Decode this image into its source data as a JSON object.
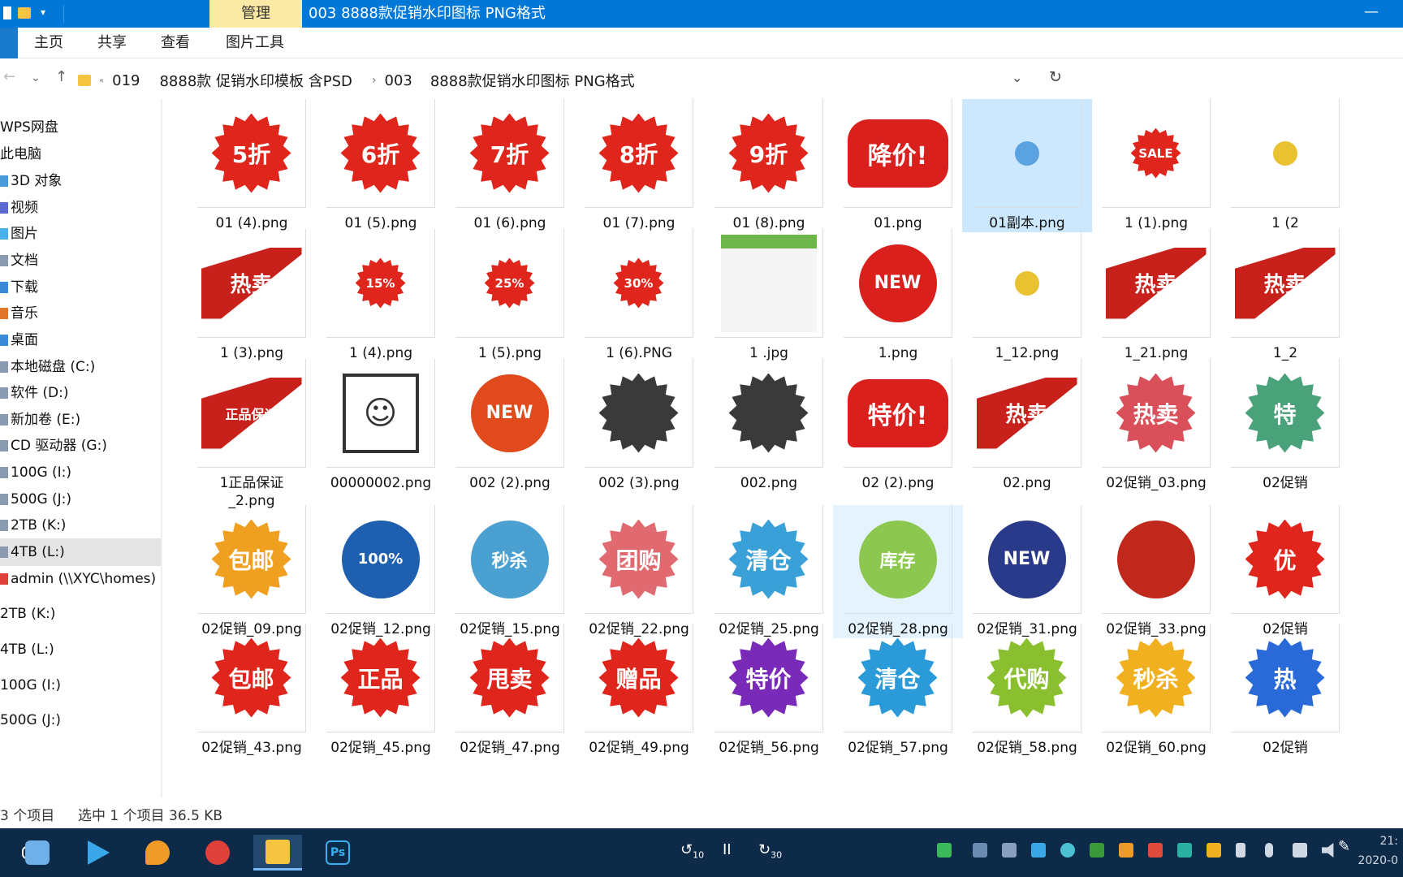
{
  "window": {
    "context_tab": "管理",
    "title": "003    8888款促销水印图标 PNG格式",
    "minimize": "—"
  },
  "ribbon": {
    "tabs": [
      "主页",
      "共享",
      "查看",
      "图片工具"
    ]
  },
  "address": {
    "crumbs": [
      "019",
      "8888款 促销水印模板 含PSD",
      "003",
      "8888款促销水印图标 PNG格式"
    ],
    "dropdown_icon": "chevron-down-icon",
    "refresh_icon": "refresh-icon"
  },
  "sidebar": {
    "items": [
      "WPS网盘",
      "此电脑",
      "3D 对象",
      "视频",
      "图片",
      "文档",
      "下载",
      "音乐",
      "桌面",
      "本地磁盘 (C:)",
      "软件 (D:)",
      "新加卷 (E:)",
      "CD 驱动器 (G:)",
      "100G  (I:)",
      "500G (J:)",
      "2TB (K:)",
      "4TB (L:)",
      "admin (\\\\XYC\\homes)",
      "2TB (K:)",
      "4TB (L:)",
      "100G  (I:)",
      "500G (J:)"
    ],
    "selected_index": 16
  },
  "files": {
    "rows": [
      [
        {
          "name": "01 (4).png",
          "badge": "5折",
          "color": "#e0261c",
          "shape": "burst"
        },
        {
          "name": "01 (5).png",
          "badge": "6折",
          "color": "#e0261c",
          "shape": "burst"
        },
        {
          "name": "01 (6).png",
          "badge": "7折",
          "color": "#e0261c",
          "shape": "burst"
        },
        {
          "name": "01 (7).png",
          "badge": "8折",
          "color": "#e0261c",
          "shape": "burst"
        },
        {
          "name": "01 (8).png",
          "badge": "9折",
          "color": "#e0261c",
          "shape": "burst"
        },
        {
          "name": "01.png",
          "badge": "降价!",
          "color": "#d9201c",
          "shape": "bubble"
        },
        {
          "name": "01副本.png",
          "badge": "",
          "color": "#5aa3e0",
          "shape": "dot"
        },
        {
          "name": "1 (1).png",
          "badge": "SALE",
          "color": "#e0261c",
          "shape": "burst-small"
        },
        {
          "name": "1 (2",
          "badge": "",
          "color": "#e8c230",
          "shape": "dot"
        }
      ],
      [
        {
          "name": "1 (3).png",
          "badge": "热卖",
          "color": "#c8201a",
          "shape": "corner"
        },
        {
          "name": "1 (4).png",
          "badge": "15%",
          "color": "#e0261c",
          "shape": "burst-small"
        },
        {
          "name": "1 (5).png",
          "badge": "25%",
          "color": "#e0261c",
          "shape": "burst-small"
        },
        {
          "name": "1 (6).PNG",
          "badge": "30%",
          "color": "#e0261c",
          "shape": "burst-small"
        },
        {
          "name": "1 .jpg",
          "badge": "",
          "color": "#6fb64a",
          "shape": "sheet"
        },
        {
          "name": "1.png",
          "badge": "NEW",
          "color": "#d9201c",
          "shape": "round"
        },
        {
          "name": "1_12.png",
          "badge": "",
          "color": "#e8c230",
          "shape": "dot"
        },
        {
          "name": "1_21.png",
          "badge": "热卖",
          "color": "#c8201a",
          "shape": "corner"
        },
        {
          "name": "1_2",
          "badge": "热卖",
          "color": "#c8201a",
          "shape": "corner"
        }
      ],
      [
        {
          "name": "1正品保证\n_2.png",
          "badge": "正品保证",
          "color": "#c8201a",
          "shape": "corner"
        },
        {
          "name": "00000002.png",
          "badge": "☺",
          "color": "#333333",
          "shape": "frame"
        },
        {
          "name": "002 (2).png",
          "badge": "NEW",
          "color": "#e04a1c",
          "shape": "round"
        },
        {
          "name": "002 (3).png",
          "badge": "",
          "color": "#3a3a3a",
          "shape": "burst"
        },
        {
          "name": "002.png",
          "badge": "",
          "color": "#3a3a3a",
          "shape": "burst"
        },
        {
          "name": "02 (2).png",
          "badge": "特价!",
          "color": "#d9201c",
          "shape": "bubble"
        },
        {
          "name": "02.png",
          "badge": "热卖",
          "color": "#c8201a",
          "shape": "corner"
        },
        {
          "name": "02促销_03.png",
          "badge": "热卖",
          "color": "#d9505a",
          "shape": "burst"
        },
        {
          "name": "02促销",
          "badge": "特",
          "color": "#4aa27a",
          "shape": "burst"
        }
      ],
      [
        {
          "name": "02促销_09.png",
          "badge": "包邮",
          "color": "#f0a020",
          "shape": "burst"
        },
        {
          "name": "02促销_12.png",
          "badge": "100%",
          "color": "#1e5fb0",
          "shape": "round"
        },
        {
          "name": "02促销_15.png",
          "badge": "秒杀",
          "color": "#4aa0d0",
          "shape": "round"
        },
        {
          "name": "02促销_22.png",
          "badge": "团购",
          "color": "#e06a70",
          "shape": "burst"
        },
        {
          "name": "02促销_25.png",
          "badge": "清仓",
          "color": "#3aa0d8",
          "shape": "burst"
        },
        {
          "name": "02促销_28.png",
          "badge": "库存",
          "color": "#8cc850",
          "shape": "round"
        },
        {
          "name": "02促销_31.png",
          "badge": "NEW",
          "color": "#2a3a8a",
          "shape": "round"
        },
        {
          "name": "02促销_33.png",
          "badge": "",
          "color": "#c0281c",
          "shape": "round"
        },
        {
          "name": "02促销",
          "badge": "优",
          "color": "#e0261c",
          "shape": "burst"
        }
      ],
      [
        {
          "name": "02促销_43.png",
          "badge": "包邮",
          "color": "#e0261c",
          "shape": "burst"
        },
        {
          "name": "02促销_45.png",
          "badge": "正品",
          "color": "#e0261c",
          "shape": "burst"
        },
        {
          "name": "02促销_47.png",
          "badge": "甩卖",
          "color": "#e0261c",
          "shape": "burst"
        },
        {
          "name": "02促销_49.png",
          "badge": "赠品",
          "color": "#e0261c",
          "shape": "burst"
        },
        {
          "name": "02促销_56.png",
          "badge": "特价",
          "color": "#7a2ab8",
          "shape": "burst"
        },
        {
          "name": "02促销_57.png",
          "badge": "清仓",
          "color": "#2a9ad8",
          "shape": "burst"
        },
        {
          "name": "02促销_58.png",
          "badge": "代购",
          "color": "#8ac030",
          "shape": "burst"
        },
        {
          "name": "02促销_60.png",
          "badge": "秒杀",
          "color": "#f0b020",
          "shape": "burst"
        },
        {
          "name": "02促销",
          "badge": "热",
          "color": "#2a6ad8",
          "shape": "burst"
        }
      ]
    ],
    "selected": "01副本.png",
    "hovered": "02促销_28.png"
  },
  "status": {
    "count": "3 个项目",
    "selection": "选中 1 个项目  36.5 KB"
  },
  "taskbar": {
    "apps": [
      "qq-icon",
      "video-player-icon",
      "fish-icon",
      "screen-recorder-icon",
      "file-explorer-icon",
      "photoshop-icon"
    ],
    "photoshop_label": "Ps",
    "player": {
      "back": "10",
      "pause": "II",
      "forward": "30"
    },
    "clock_time": "21:",
    "clock_date": "2020-0"
  }
}
